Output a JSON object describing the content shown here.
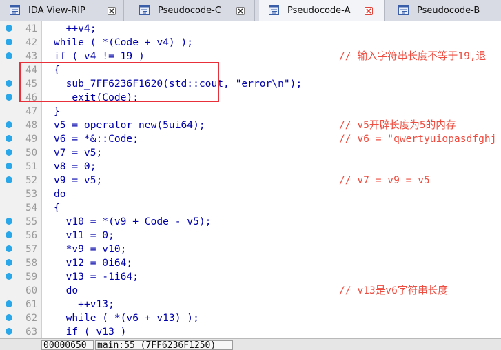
{
  "tabs": [
    {
      "label": "IDA View-RIP",
      "active": false,
      "close_style": "x"
    },
    {
      "label": "Pseudocode-C",
      "active": false,
      "close_style": "x"
    },
    {
      "label": "Pseudocode-A",
      "active": true,
      "close_style": "x-red"
    },
    {
      "label": "Pseudocode-B",
      "active": false,
      "close_style": "x"
    }
  ],
  "lines": [
    {
      "num": "41",
      "bp": true,
      "code": "  ++v4;",
      "comment": ""
    },
    {
      "num": "42",
      "bp": true,
      "code": "while ( *(Code + v4) );",
      "comment": ""
    },
    {
      "num": "43",
      "bp": true,
      "code": "if ( v4 != 19 )",
      "comment": "// 输入字符串长度不等于19,退"
    },
    {
      "num": "44",
      "bp": false,
      "code": "{",
      "comment": ""
    },
    {
      "num": "45",
      "bp": true,
      "code": "  sub_7FF6236F1620(std::cout, \"error\\n\");",
      "comment": ""
    },
    {
      "num": "46",
      "bp": true,
      "code": "  _exit(Code);",
      "comment": ""
    },
    {
      "num": "47",
      "bp": false,
      "code": "}",
      "comment": ""
    },
    {
      "num": "48",
      "bp": true,
      "code": "v5 = operator new(5ui64);",
      "comment": "// v5开辟长度为5的内存"
    },
    {
      "num": "49",
      "bp": true,
      "code": "v6 = *&::Code;",
      "comment": "// v6 = \"qwertyuiopasdfghj"
    },
    {
      "num": "50",
      "bp": true,
      "code": "v7 = v5;",
      "comment": ""
    },
    {
      "num": "51",
      "bp": true,
      "code": "v8 = 0;",
      "comment": ""
    },
    {
      "num": "52",
      "bp": true,
      "code": "v9 = v5;",
      "comment": "// v7 = v9 = v5"
    },
    {
      "num": "53",
      "bp": false,
      "code": "do",
      "comment": ""
    },
    {
      "num": "54",
      "bp": false,
      "code": "{",
      "comment": ""
    },
    {
      "num": "55",
      "bp": true,
      "code": "  v10 = *(v9 + Code - v5);",
      "comment": ""
    },
    {
      "num": "56",
      "bp": true,
      "code": "  v11 = 0;",
      "comment": ""
    },
    {
      "num": "57",
      "bp": true,
      "code": "  *v9 = v10;",
      "comment": ""
    },
    {
      "num": "58",
      "bp": true,
      "code": "  v12 = 0i64;",
      "comment": ""
    },
    {
      "num": "59",
      "bp": true,
      "code": "  v13 = -1i64;",
      "comment": ""
    },
    {
      "num": "60",
      "bp": false,
      "code": "  do",
      "comment": "// v13是v6字符串长度"
    },
    {
      "num": "61",
      "bp": true,
      "code": "    ++v13;",
      "comment": ""
    },
    {
      "num": "62",
      "bp": true,
      "code": "  while ( *(v6 + v13) );",
      "comment": ""
    },
    {
      "num": "63",
      "bp": true,
      "code": "  if ( v13 )",
      "comment": ""
    }
  ],
  "status": {
    "address": "00000650",
    "location": "main:55 (7FF6236F1250)"
  },
  "colors": {
    "breakpoint": "#2aa7e8",
    "comment": "#ee4c3f",
    "highlight_box": "#e8303a",
    "code": "#0000aa"
  }
}
